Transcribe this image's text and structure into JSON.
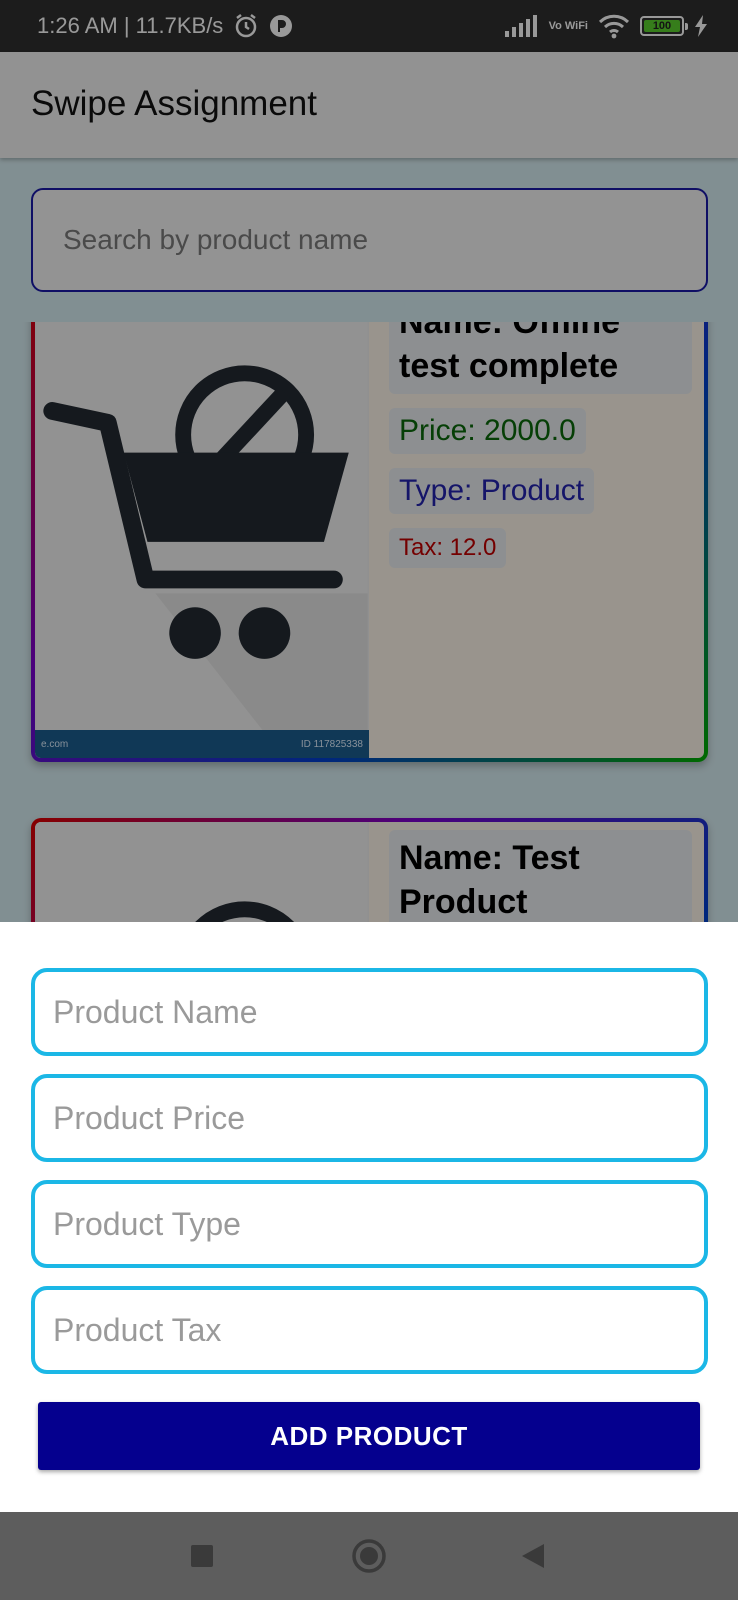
{
  "status_bar": {
    "time_speed": "1:26 AM | 11.7KB/s",
    "network_label": "Vo WiFi",
    "battery": "100"
  },
  "app_bar": {
    "title": "Swipe Assignment"
  },
  "search": {
    "placeholder": "Search by product name"
  },
  "products": [
    {
      "name": "Name: Offline test complete",
      "price": "Price: 2000.0",
      "type": "Type: Product",
      "tax": "Tax: 12.0",
      "image_footer_left": "e.com",
      "image_footer_right": "ID 117825338"
    },
    {
      "name": "Name: Test Product"
    }
  ],
  "form": {
    "name_placeholder": "Product Name",
    "price_placeholder": "Product Price",
    "type_placeholder": "Product Type",
    "tax_placeholder": "Product Tax",
    "add_label": "ADD PRODUCT"
  },
  "colors": {
    "accent_field_border": "#1bb7e6",
    "button_bg": "#05008e",
    "price_text": "#0a6a0a",
    "type_text": "#2323b0",
    "tax_text": "#c20000"
  }
}
